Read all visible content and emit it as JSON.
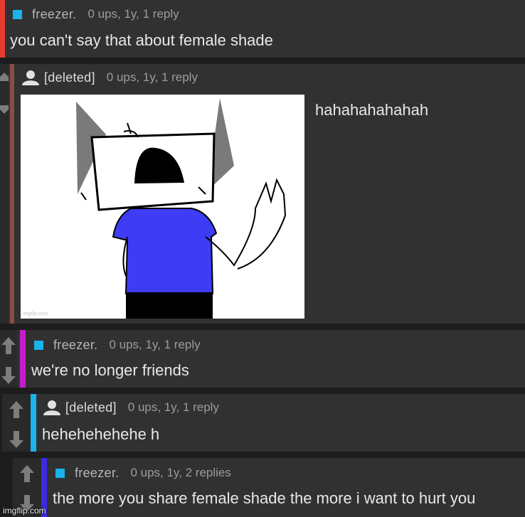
{
  "colors": {
    "bar_red": "#e83a2f",
    "bar_brown": "#8c4a49",
    "bar_magenta": "#c41ecb",
    "bar_cyan": "#19b4ea",
    "bar_blue": "#3b2be3",
    "mod_square": "#19b4ea",
    "background": "#1d1d1d",
    "comment_bg": "#313131"
  },
  "comments": [
    {
      "username": "freezer.",
      "user_type": "mod-square-icon",
      "meta": "0 ups, 1y, 1 reply",
      "text": "you can't say that about female shade"
    },
    {
      "username": "[deleted]",
      "user_type": "deleted-user-avatar-icon",
      "meta": "0 ups, 1y, 1 reply",
      "text": "hahahahahahah",
      "image_watermark": "imgflip.com"
    },
    {
      "username": "freezer.",
      "user_type": "mod-square-icon",
      "meta": "0 ups, 1y, 1 reply",
      "text": "we're no longer friends"
    },
    {
      "username": "[deleted]",
      "user_type": "deleted-user-avatar-icon",
      "meta": "0 ups, 1y, 1 reply",
      "text": "hehehehehehe h"
    },
    {
      "username": "freezer.",
      "user_type": "mod-square-icon",
      "meta": "0 ups, 1y, 2 replies",
      "text": "the more you share female shade the more i want to hurt you"
    }
  ],
  "site_watermark": "imgflip.com"
}
